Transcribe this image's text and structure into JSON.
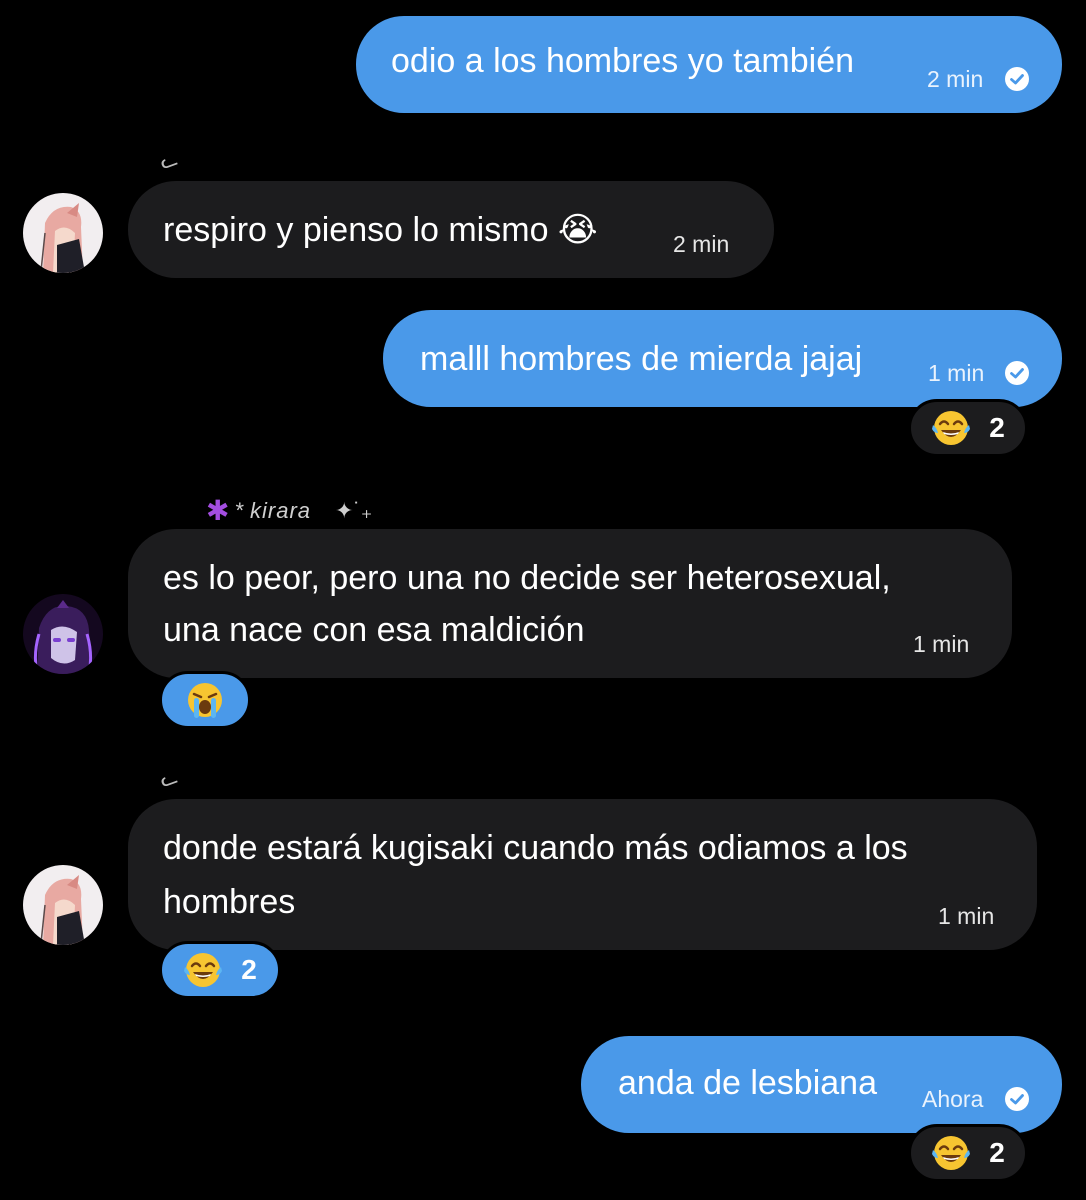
{
  "messages": [
    {
      "text": "odio a los hombres yo también",
      "time": "2 min"
    },
    {
      "text": "respiro y pienso lo mismo 😭",
      "time": "2 min"
    },
    {
      "text": "malll hombres de mierda jajaj",
      "time": "1 min",
      "reaction_count": "2"
    },
    {
      "line1": "es lo peor, pero una no decide ser heterosexual,",
      "line2": "una nace con esa maldición",
      "time": "1 min"
    },
    {
      "line1": "donde estará kugisaki cuando más odiamos a los",
      "line2": "hombres",
      "time": "1 min",
      "reaction_count": "2"
    },
    {
      "text": "anda de lesbiana",
      "time": "Ahora",
      "reaction_count": "2"
    }
  ],
  "senders": {
    "reply_glyph": "ᓚ",
    "kirara_prefix": "* ",
    "kirara_name": "kirara",
    "kirara_suffix": "✦˙₊"
  },
  "colors": {
    "outgoing": "#4a99e9",
    "incoming": "#1c1c1e",
    "background": "#000000"
  },
  "icons": {
    "read": "check-circle-icon",
    "reaction": "tears-of-joy-emoji",
    "crying": "loudly-crying-emoji"
  }
}
